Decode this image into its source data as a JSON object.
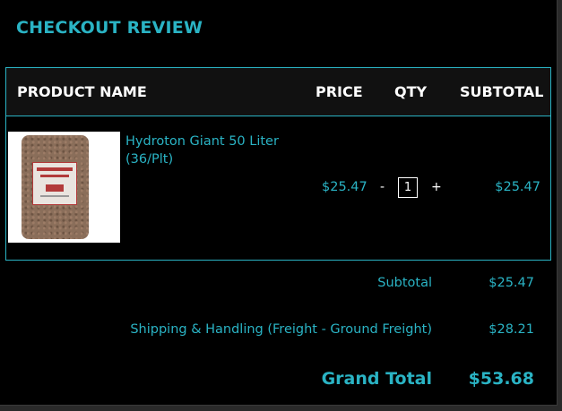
{
  "page": {
    "title": "CHECKOUT REVIEW"
  },
  "table": {
    "headers": {
      "product": "PRODUCT NAME",
      "price": "PRICE",
      "qty": "QTY",
      "subtotal": "SUBTOTAL"
    },
    "items": [
      {
        "name": "Hydroton Giant 50 Liter (36/Plt)",
        "price": "$25.47",
        "qty_minus": "-",
        "qty": "1",
        "qty_plus": "+",
        "subtotal": "$25.47"
      }
    ]
  },
  "summary": {
    "subtotal_label": "Subtotal",
    "subtotal_value": "$25.47",
    "shipping_label": "Shipping & Handling (Freight - Ground Freight)",
    "shipping_value": "$28.21",
    "grand_total_label": "Grand Total",
    "grand_total_value": "$53.68"
  },
  "colors": {
    "accent": "#2ab3c4",
    "background": "#000000",
    "header_bg": "#111111"
  },
  "icons": {
    "product_image": "hydroton-bag-image"
  }
}
